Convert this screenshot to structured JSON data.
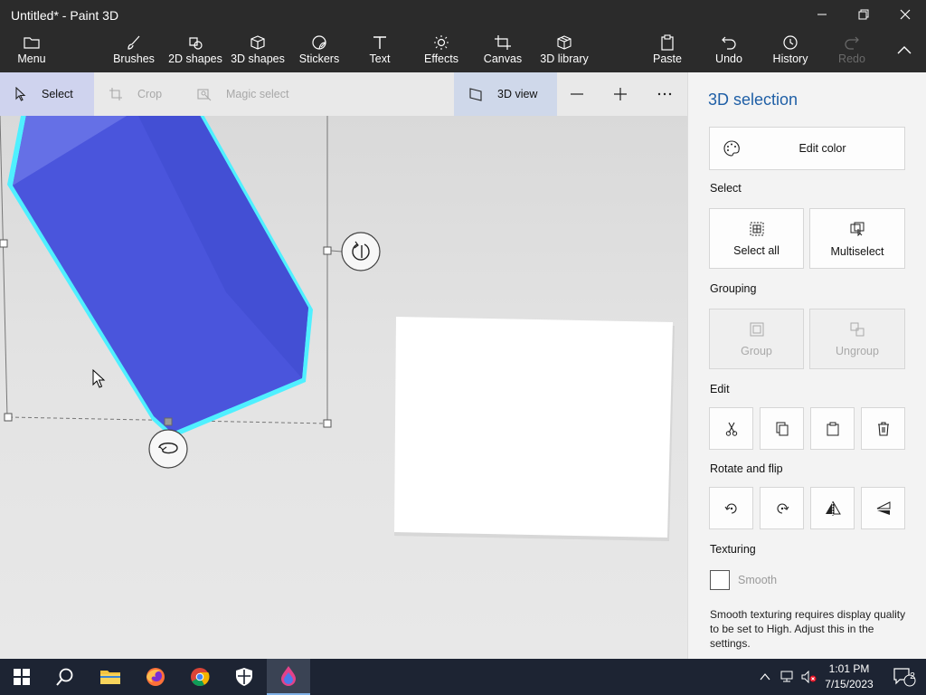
{
  "window": {
    "title": "Untitled* - Paint 3D"
  },
  "ribbon": {
    "menu": "Menu",
    "brushes": "Brushes",
    "shapes2d": "2D shapes",
    "shapes3d": "3D shapes",
    "stickers": "Stickers",
    "text": "Text",
    "effects": "Effects",
    "canvas": "Canvas",
    "library3d": "3D library",
    "paste": "Paste",
    "undo": "Undo",
    "history": "History",
    "redo": "Redo"
  },
  "toolbar": {
    "select": "Select",
    "crop": "Crop",
    "magic_select": "Magic select",
    "view3d": "3D view"
  },
  "panel": {
    "title": "3D selection",
    "edit_color": "Edit color",
    "select_section": "Select",
    "select_all": "Select all",
    "multiselect": "Multiselect",
    "grouping_section": "Grouping",
    "group": "Group",
    "ungroup": "Ungroup",
    "edit_section": "Edit",
    "rotate_section": "Rotate and flip",
    "texturing_section": "Texturing",
    "smooth": "Smooth",
    "smooth_note": "Smooth texturing requires display quality to be set to High. Adjust this in the settings."
  },
  "taskbar": {
    "time": "1:01 PM",
    "date": "7/15/2023",
    "notification_count": "2"
  },
  "colors": {
    "shape_fill": "#4a55dc",
    "shape_outline": "#4ff0ff",
    "accent": "#1f5fa6"
  }
}
